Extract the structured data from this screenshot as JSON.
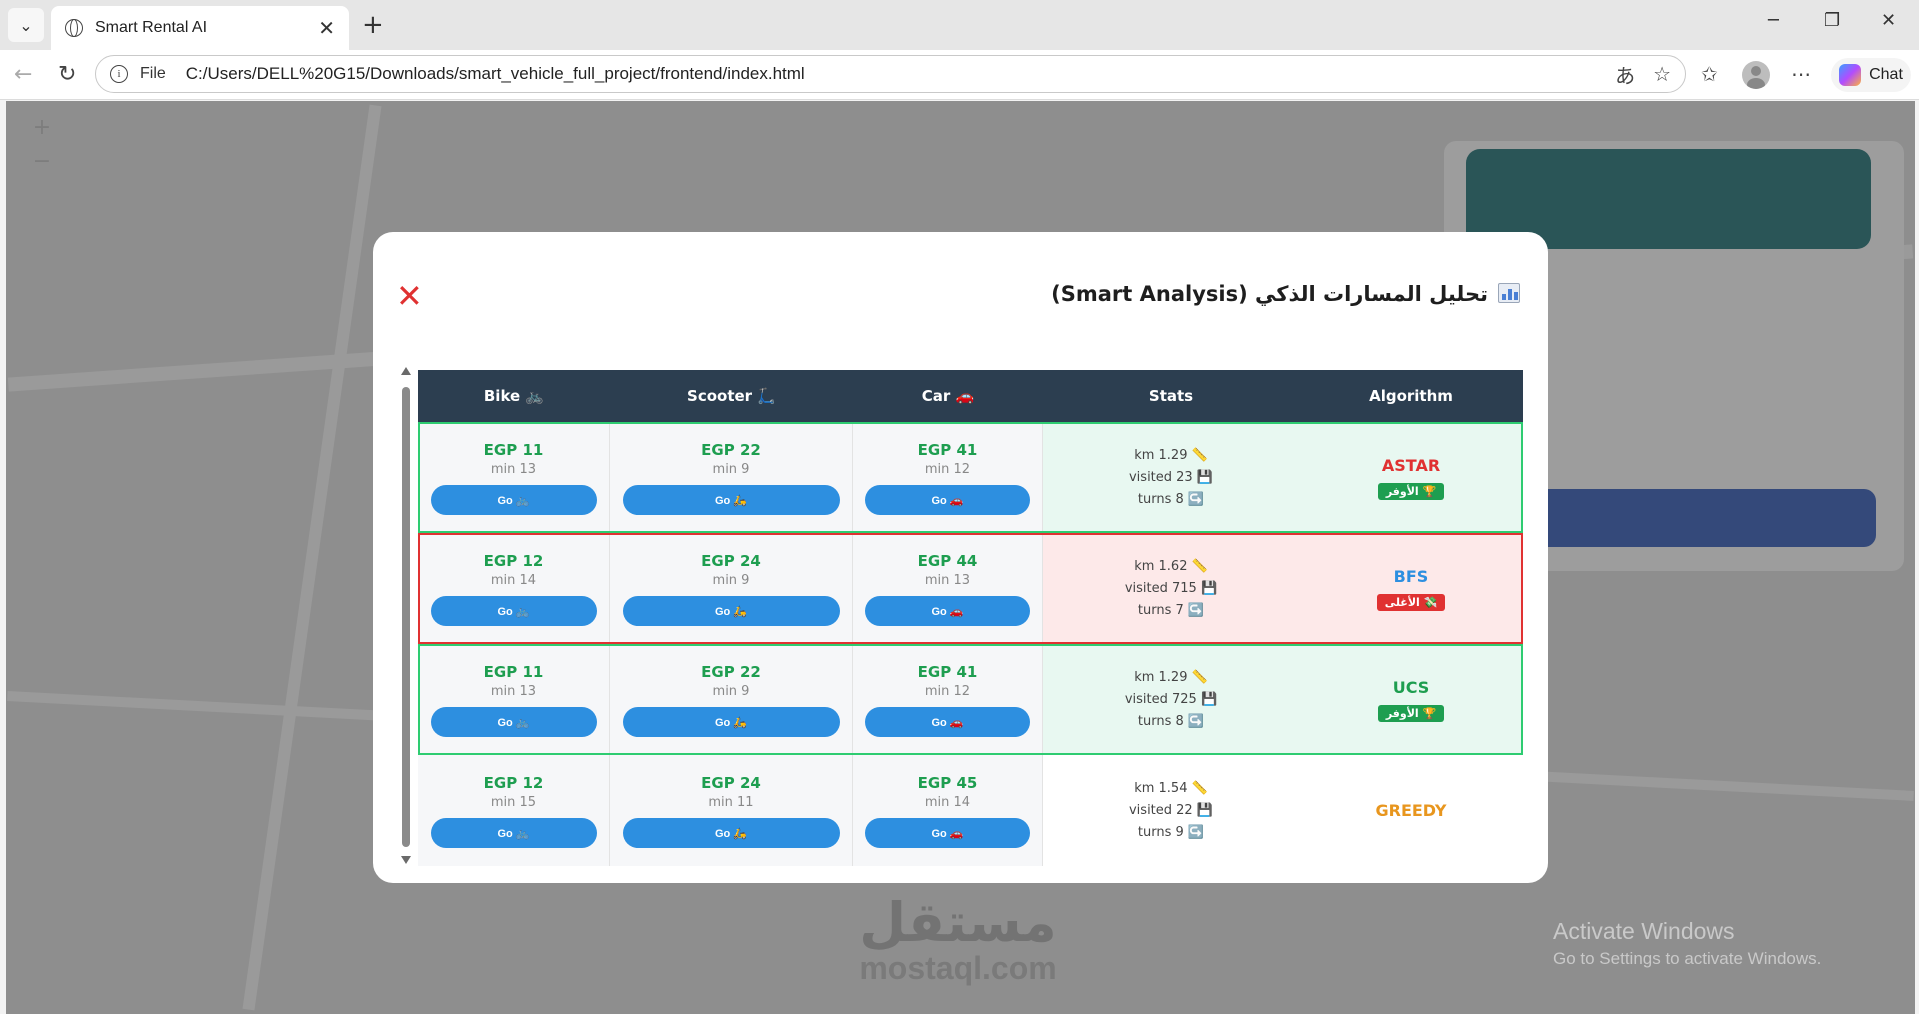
{
  "browser": {
    "tab_title": "Smart Rental AI",
    "address_label": "File",
    "url": "C:/Users/DELL%20G15/Downloads/smart_vehicle_full_project/frontend/index.html",
    "chat_label": "Chat"
  },
  "modal": {
    "title": "تحليل المسارات الذكي (Smart Analysis)",
    "close_label": "✕",
    "headers": {
      "bike": "Bike 🚲",
      "scooter": "Scooter 🛴",
      "car": "Car 🚗",
      "stats": "Stats",
      "algorithm": "Algorithm"
    },
    "rows": [
      {
        "algorithm": "ASTAR",
        "algo_color": "#e03131",
        "badge": "🏆 الأوفر",
        "badge_style": "green",
        "status": "best",
        "bike": {
          "price": "EGP 11",
          "time": "min 13",
          "go": "Go 🚲"
        },
        "scooter": {
          "price": "EGP 22",
          "time": "min 9",
          "go": "Go 🛵"
        },
        "car": {
          "price": "EGP 41",
          "time": "min 12",
          "go": "Go 🚗"
        },
        "stats": {
          "km": "km 1.29 📏",
          "visited": "visited 23 💾",
          "turns": "turns 8 ↪️"
        }
      },
      {
        "algorithm": "BFS",
        "algo_color": "#2d8fe0",
        "badge": "💸 الأغلى",
        "badge_style": "red",
        "status": "worst",
        "bike": {
          "price": "EGP 12",
          "time": "min 14",
          "go": "Go 🚲"
        },
        "scooter": {
          "price": "EGP 24",
          "time": "min 9",
          "go": "Go 🛵"
        },
        "car": {
          "price": "EGP 44",
          "time": "min 13",
          "go": "Go 🚗"
        },
        "stats": {
          "km": "km 1.62 📏",
          "visited": "visited 715 💾",
          "turns": "turns 7 ↪️"
        }
      },
      {
        "algorithm": "UCS",
        "algo_color": "#1e9e50",
        "badge": "🏆 الأوفر",
        "badge_style": "green",
        "status": "best",
        "bike": {
          "price": "EGP 11",
          "time": "min 13",
          "go": "Go 🚲"
        },
        "scooter": {
          "price": "EGP 22",
          "time": "min 9",
          "go": "Go 🛵"
        },
        "car": {
          "price": "EGP 41",
          "time": "min 12",
          "go": "Go 🚗"
        },
        "stats": {
          "km": "km 1.29 📏",
          "visited": "visited 725 💾",
          "turns": "turns 8 ↪️"
        }
      },
      {
        "algorithm": "GREEDY",
        "algo_color": "#e8961e",
        "badge": "",
        "badge_style": "",
        "status": "plain",
        "bike": {
          "price": "EGP 12",
          "time": "min 15",
          "go": "Go 🚲"
        },
        "scooter": {
          "price": "EGP 24",
          "time": "min 11",
          "go": "Go 🛵"
        },
        "car": {
          "price": "EGP 45",
          "time": "min 14",
          "go": "Go 🚗"
        },
        "stats": {
          "km": "km 1.54 📏",
          "visited": "visited 22 💾",
          "turns": "turns 9 ↪️"
        }
      }
    ]
  },
  "watermark": {
    "logo": "مستقل",
    "url": "mostaql.com"
  },
  "activation": {
    "title": "Activate Windows",
    "subtitle": "Go to Settings to activate Windows."
  }
}
